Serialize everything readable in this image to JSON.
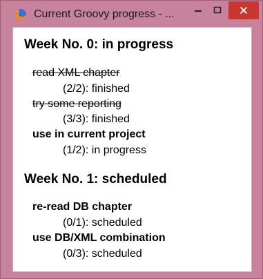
{
  "window": {
    "title": "Current Groovy progress - ...",
    "icon": "firefox-icon",
    "controls": {
      "minimize": "minimize-icon",
      "maximize": "maximize-icon",
      "close": "close-icon"
    }
  },
  "weeks": [
    {
      "title": "Week No. 0: in progress",
      "tasks": [
        {
          "label": "read XML chapter",
          "status": "(2/2): finished",
          "state": "finished"
        },
        {
          "label": "try some reporting",
          "status": "(3/3): finished",
          "state": "finished"
        },
        {
          "label": "use in current project",
          "status": "(1/2): in progress",
          "state": "in progress"
        }
      ]
    },
    {
      "title": "Week No. 1: scheduled",
      "tasks": [
        {
          "label": "re-read DB chapter",
          "status": "(0/1): scheduled",
          "state": "scheduled"
        },
        {
          "label": "use DB/XML combination",
          "status": "(0/3): scheduled",
          "state": "scheduled"
        }
      ]
    }
  ],
  "colors": {
    "frame": "#c8839c",
    "close_button": "#c7372f"
  }
}
